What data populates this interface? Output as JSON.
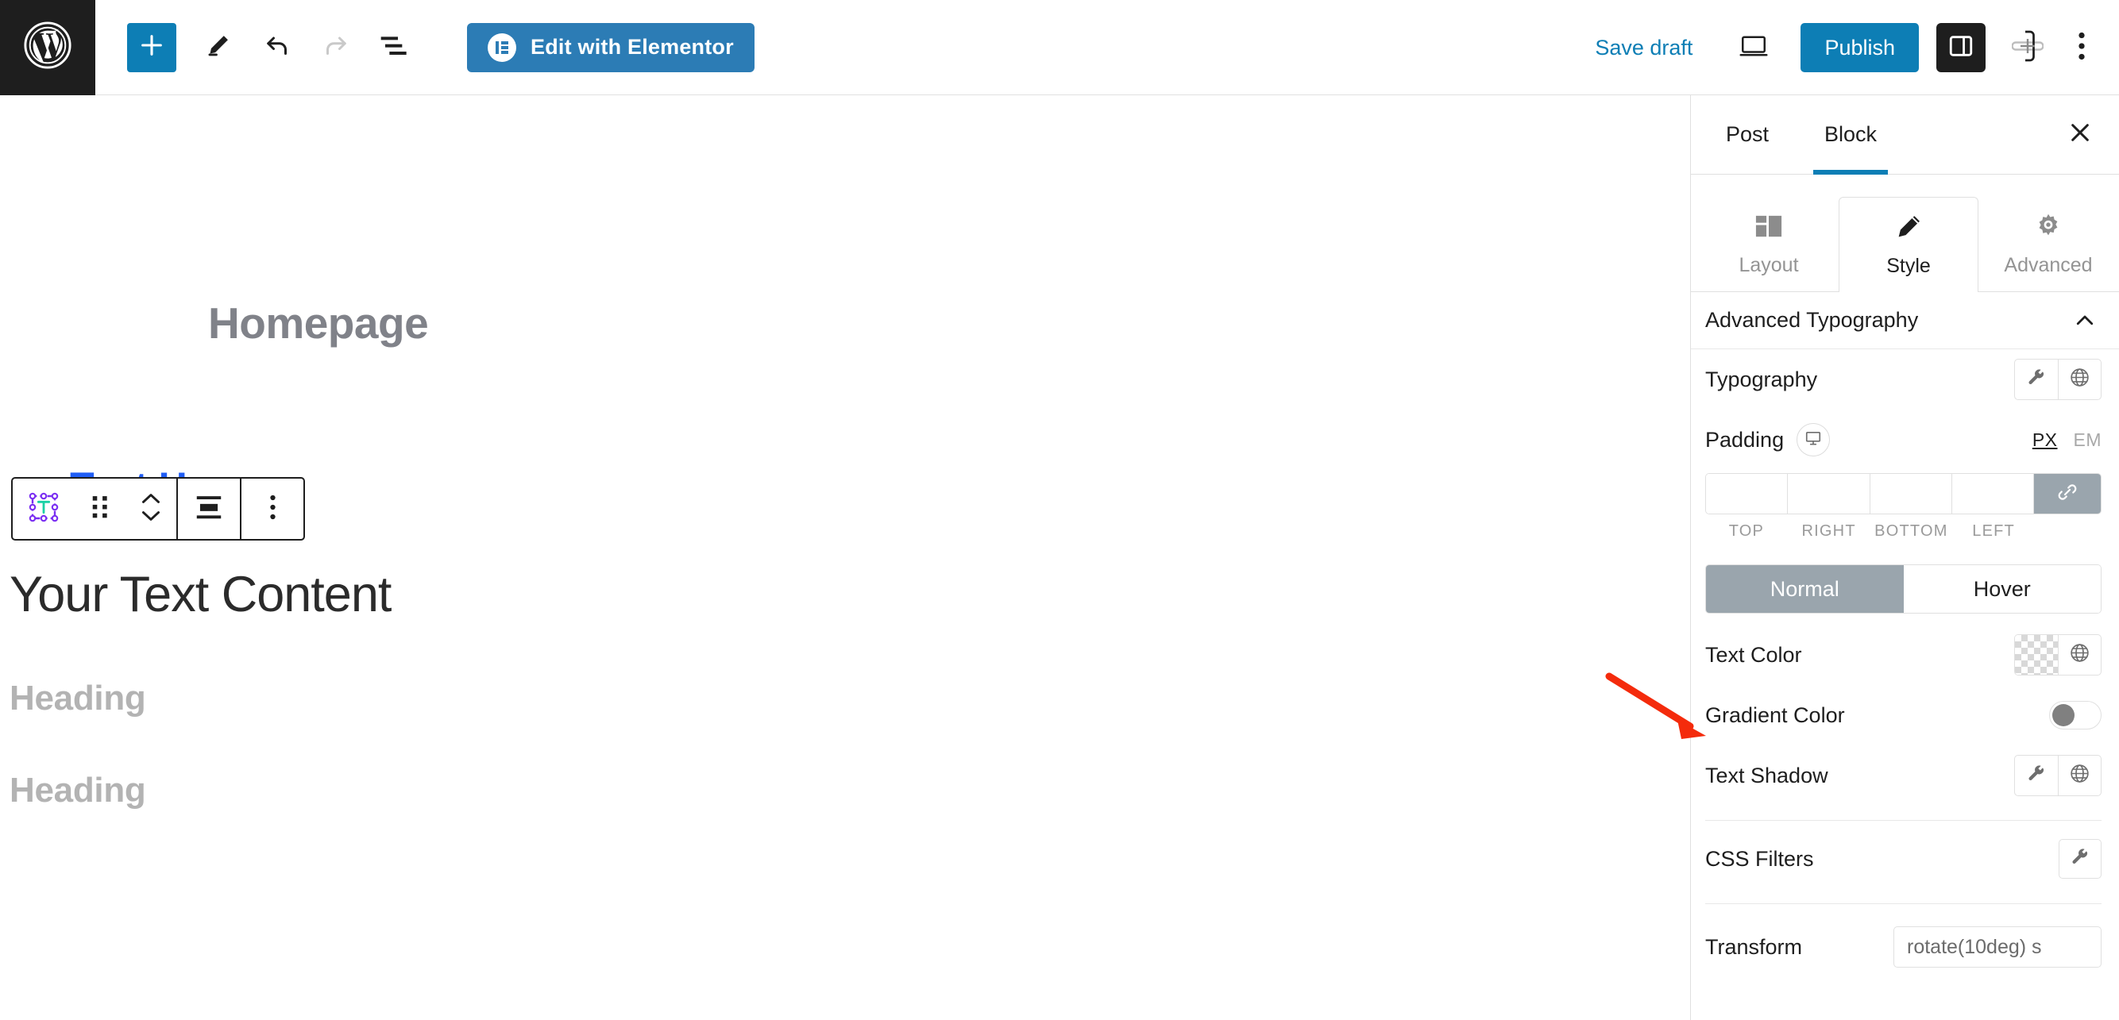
{
  "topbar": {
    "wp_logo": "wordpress-logo",
    "add_block_label": "+",
    "tools": [
      {
        "name": "add-block-button",
        "icon": "plus-icon"
      },
      {
        "name": "edit-tool-button",
        "icon": "pencil-icon"
      },
      {
        "name": "undo-button",
        "icon": "undo-arrow-icon"
      },
      {
        "name": "redo-button",
        "icon": "redo-arrow-icon"
      },
      {
        "name": "document-overview-button",
        "icon": "list-view-icon"
      }
    ],
    "elementor_button_label": "Edit with Elementor",
    "save_draft_label": "Save draft",
    "preview_label": "preview-desktop-icon",
    "publish_label": "Publish",
    "settings_toggle_icon": "sidebar-panel-icon",
    "plugin_icon": "elementor-plus-icon",
    "kebab_icon": "vertical-ellipsis-icon"
  },
  "canvas": {
    "page_title": "Homepage",
    "blue_heading": "ng Text Here",
    "blue_heading_full": "Heading Text Here",
    "text_content": "Your Text Content",
    "heading_1": "Heading",
    "heading_2": "Heading"
  },
  "block_toolbar": {
    "items": [
      {
        "name": "block-type-text-icon",
        "icon": "text-block-icon"
      },
      {
        "name": "drag-handle",
        "icon": "drag-dots-icon"
      },
      {
        "name": "move-up-down",
        "icon": "chevron-up-down-icon"
      },
      {
        "name": "align-button",
        "icon": "align-center-icon"
      },
      {
        "name": "more-options-button",
        "icon": "vertical-ellipsis-icon"
      }
    ]
  },
  "sidebar": {
    "tabs": [
      {
        "label": "Post",
        "active": false
      },
      {
        "label": "Block",
        "active": true
      }
    ],
    "close_icon": "close-icon",
    "mode_tabs": [
      {
        "label": "Layout",
        "icon": "layout-icon",
        "active": false
      },
      {
        "label": "Style",
        "icon": "pencil-icon",
        "active": true
      },
      {
        "label": "Advanced",
        "icon": "gear-icon",
        "active": false
      }
    ],
    "section": {
      "title": "Advanced Typography",
      "collapse_icon": "chevron-up-icon"
    },
    "typography": {
      "label": "Typography",
      "wrench_icon": "wrench-icon",
      "globe_icon": "globe-icon"
    },
    "padding": {
      "label": "Padding",
      "device_icon": "desktop-icon",
      "units": [
        {
          "label": "PX",
          "active": true
        },
        {
          "label": "EM",
          "active": false
        }
      ],
      "values": [
        "",
        "",
        "",
        ""
      ],
      "side_labels": [
        "TOP",
        "RIGHT",
        "BOTTOM",
        "LEFT"
      ],
      "link_icon": "link-icon"
    },
    "state_toggle": [
      {
        "label": "Normal",
        "active": true
      },
      {
        "label": "Hover",
        "active": false
      }
    ],
    "text_color": {
      "label": "Text Color",
      "swatch": "transparent",
      "globe_icon": "globe-icon"
    },
    "gradient_color": {
      "label": "Gradient Color",
      "toggle_on": false
    },
    "text_shadow": {
      "label": "Text Shadow",
      "wrench_icon": "wrench-icon",
      "globe_icon": "globe-icon"
    },
    "css_filters": {
      "label": "CSS Filters",
      "wrench_icon": "wrench-icon"
    },
    "transform": {
      "label": "Transform",
      "value": "rotate(10deg) s"
    }
  },
  "annotation": {
    "arrow_color": "#f42b0c",
    "points_to": "Text Color"
  },
  "colors": {
    "wp_bar_dark": "#1e1e1e",
    "accent_blue": "#0d7eb5",
    "elementor_blue": "#2c7cb5",
    "canvas_blue_heading": "#1f5df5",
    "muted_grey": "#b3b3b3",
    "toggle_active_grey": "#9aa5ad"
  }
}
